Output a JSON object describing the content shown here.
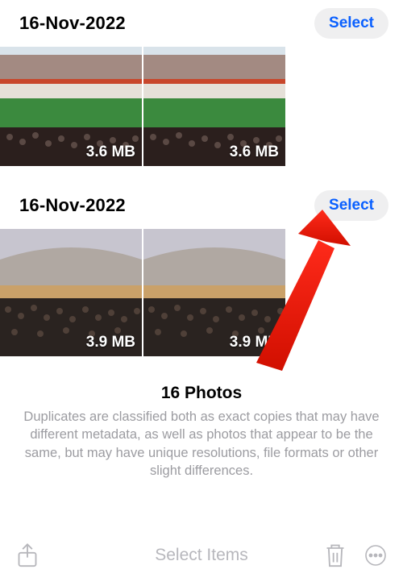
{
  "groups": [
    {
      "date": "16-Nov-2022",
      "select_label": "Select",
      "photos": [
        {
          "size": "3.6 MB"
        },
        {
          "size": "3.6 MB"
        }
      ]
    },
    {
      "date": "16-Nov-2022",
      "select_label": "Select",
      "photos": [
        {
          "size": "3.9 MB"
        },
        {
          "size": "3.9 MB"
        }
      ]
    }
  ],
  "summary": {
    "title": "16 Photos",
    "desc": "Duplicates are classified both as exact copies that may have different metadata, as well as photos that appear to be the same, but may have unique resolutions, file formats or other slight differences."
  },
  "toolbar": {
    "center_label": "Select Items"
  }
}
